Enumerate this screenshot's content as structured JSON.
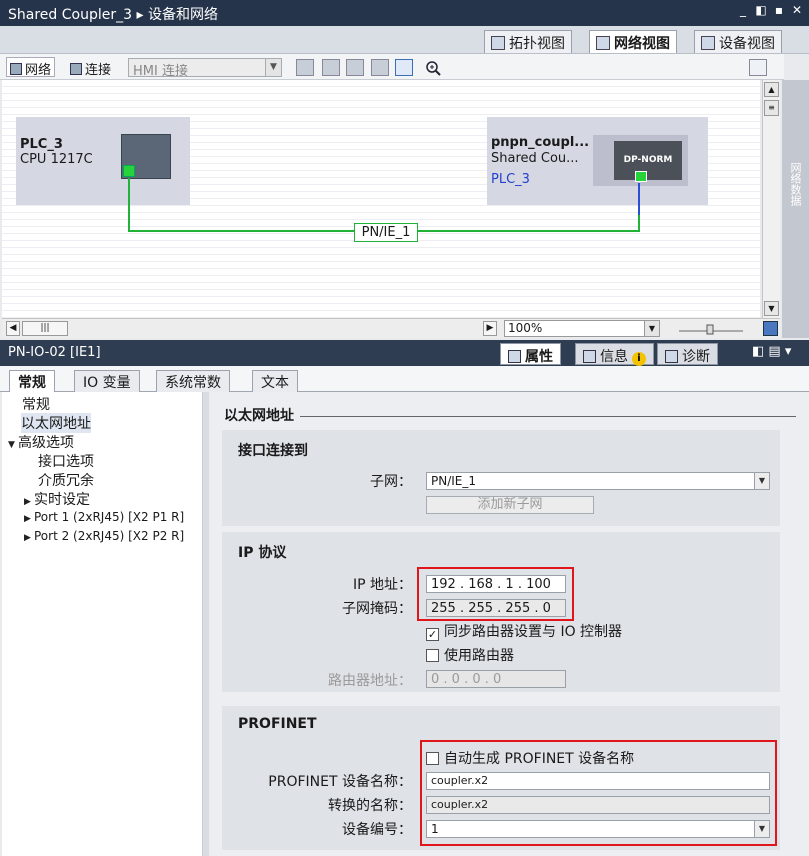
{
  "title": {
    "project": "Shared Coupler_3",
    "separator": "▸",
    "section": "设备和网络"
  },
  "window_controls": [
    "_",
    "◧",
    "▪",
    "✕"
  ],
  "view_tabs": [
    {
      "label": "拓扑视图",
      "icon": "topology-icon"
    },
    {
      "label": "网络视图",
      "icon": "network-icon",
      "active": true
    },
    {
      "label": "设备视图",
      "icon": "device-icon"
    }
  ],
  "toolbar": {
    "network": "网络",
    "connect": "连接",
    "hmi_connection": "HMI 连接"
  },
  "devices": {
    "plc": {
      "name": "PLC_3",
      "type": "CPU 1217C"
    },
    "coupler": {
      "name": "pnpn_coupl...",
      "type": "Shared Cou...",
      "link": "PLC_3",
      "module": "DP-NORM"
    }
  },
  "subnet_label": "PN/IE_1",
  "side_tab": "网络数据",
  "zoom": "100%",
  "inspector": {
    "title": "PN-IO-02 [IE1]",
    "tabs": [
      "属性",
      "信息",
      "诊断"
    ],
    "property_tabs": [
      "常规",
      "IO 变量",
      "系统常数",
      "文本"
    ]
  },
  "nav": {
    "items": [
      "常规",
      "以太网地址",
      "高级选项",
      "接口选项",
      "介质冗余",
      "实时设定",
      "Port 1 (2xRJ45) [X2 P1 R]",
      "Port 2 (2xRJ45) [X2 P2 R]"
    ]
  },
  "content": {
    "section_title": "以太网地址",
    "interface_group": "接口连接到",
    "subnet_label": "子网：",
    "subnet_value": "PN/IE_1",
    "add_subnet": "添加新子网",
    "ip_group": "IP 协议",
    "ip_label": "IP 地址：",
    "ip_value": "192 . 168 . 1    . 100",
    "mask_label": "子网掩码：",
    "mask_value": "255 . 255 . 255 . 0",
    "sync_router": "同步路由器设置与 IO 控制器",
    "use_router": "使用路由器",
    "router_label": "路由器地址：",
    "router_value": "0    . 0    . 0    . 0",
    "profinet_group": "PROFINET",
    "auto_name": "自动生成 PROFINET 设备名称",
    "device_name_label": "PROFINET 设备名称：",
    "device_name_value": "coupler.x2",
    "converted_label": "转换的名称：",
    "converted_value": "coupler.x2",
    "device_number_label": "设备编号：",
    "device_number_value": "1"
  }
}
